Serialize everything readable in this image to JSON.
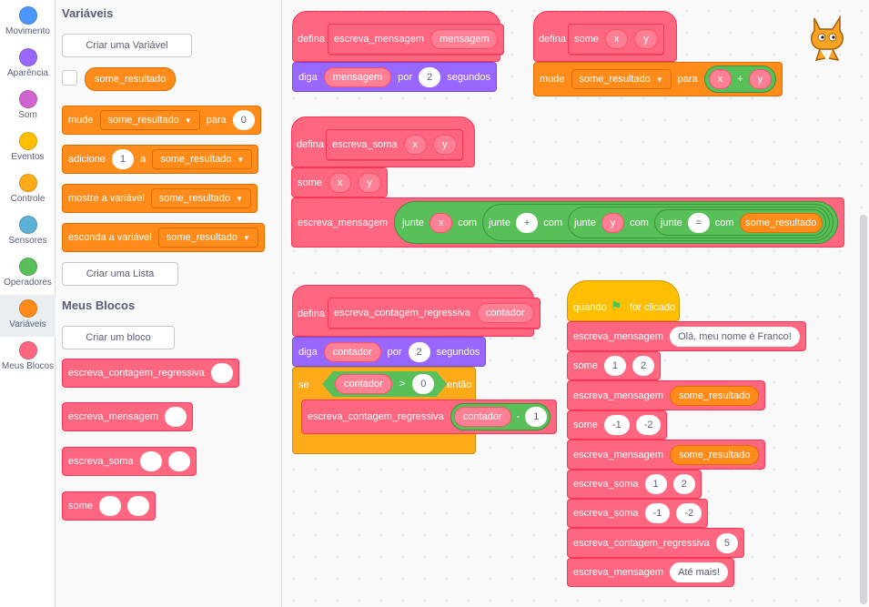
{
  "categories": [
    {
      "label": "Movimento",
      "color": "#4c97ff"
    },
    {
      "label": "Aparência",
      "color": "#9966ff"
    },
    {
      "label": "Som",
      "color": "#cf63cf"
    },
    {
      "label": "Eventos",
      "color": "#ffbf00"
    },
    {
      "label": "Controle",
      "color": "#ffab19"
    },
    {
      "label": "Sensores",
      "color": "#5cb1d6"
    },
    {
      "label": "Operadores",
      "color": "#59c059"
    },
    {
      "label": "Variáveis",
      "color": "#ff8c1a"
    },
    {
      "label": "Meus Blocos",
      "color": "#ff6680"
    }
  ],
  "palette": {
    "variables_heading": "Variáveis",
    "create_variable": "Criar uma Variável",
    "variable_name": "some_resultado",
    "set_label": "mude",
    "set_to": "para",
    "set_value": "0",
    "change_label": "adicione",
    "change_value": "1",
    "change_a": "a",
    "show_label": "mostre a variável",
    "hide_label": "esconda a variável",
    "create_list": "Criar uma Lista",
    "myblocks_heading": "Meus Blocos",
    "create_block": "Criar um bloco",
    "custom_blocks": [
      "escreva_contagem_regressiva",
      "escreva_mensagem",
      "escreva_soma",
      "some"
    ]
  },
  "script1": {
    "define": "defina",
    "name": "escreva_mensagem",
    "param": "mensagem",
    "say": "diga",
    "for": "por",
    "secs_value": "2",
    "secs": "segundos"
  },
  "script2": {
    "define": "defina",
    "name": "some",
    "x": "x",
    "y": "y",
    "set": "mude",
    "var": "some_resultado",
    "to": "para",
    "plus": "+"
  },
  "script3": {
    "define": "defina",
    "name": "escreva_soma",
    "x": "x",
    "y": "y",
    "call_some": "some",
    "call_msg": "escreva_mensagem",
    "join": "junte",
    "with": "com",
    "sep1": "+",
    "sep2": "=",
    "var": "some_resultado"
  },
  "script4": {
    "define": "defina",
    "name": "escreva_contagem_regressiva",
    "param": "contador",
    "say": "diga",
    "for": "por",
    "secs_value": "2",
    "secs": "segundos",
    "if": "se",
    "gt": ">",
    "zero": "0",
    "then": "então",
    "minus": "-",
    "one": "1"
  },
  "script5": {
    "when": "quando",
    "clicked": "for clicado",
    "b1_name": "escreva_mensagem",
    "b1_text": "Olá, meu nome é Franco!",
    "b2_name": "some",
    "b2_a": "1",
    "b2_b": "2",
    "b3_name": "escreva_mensagem",
    "b3_var": "some_resultado",
    "b4_name": "some",
    "b4_a": "-1",
    "b4_b": "-2",
    "b5_name": "escreva_mensagem",
    "b5_var": "some_resultado",
    "b6_name": "escreva_soma",
    "b6_a": "1",
    "b6_b": "2",
    "b7_name": "escreva_soma",
    "b7_a": "-1",
    "b7_b": "-2",
    "b8_name": "escreva_contagem_regressiva",
    "b8_a": "5",
    "b9_name": "escreva_mensagem",
    "b9_text": "Até mais!"
  }
}
